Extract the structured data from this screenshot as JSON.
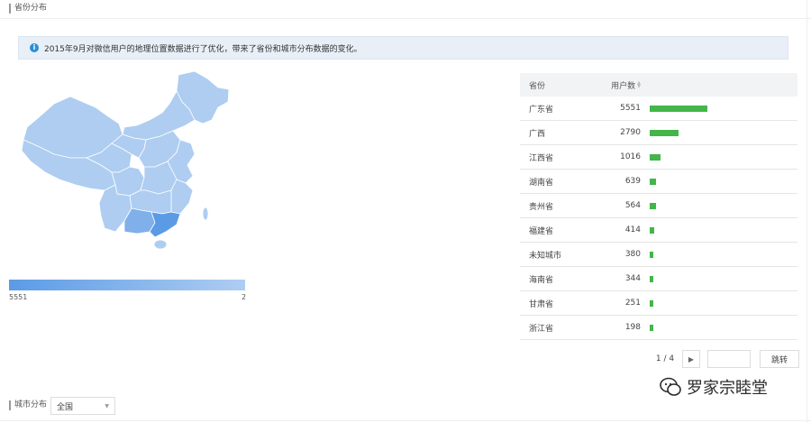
{
  "section": {
    "title": "省份分布"
  },
  "notice": {
    "text": "2015年9月对微信用户的地理位置数据进行了优化，带来了省份和城市分布数据的变化。"
  },
  "map": {
    "colors": {
      "high": "#5b9be6",
      "mid": "#7fb0ea",
      "low": "#aecdf1",
      "border": "#ffffff"
    },
    "legend_max": "5551",
    "legend_min": "2"
  },
  "table": {
    "headers": {
      "province": "省份",
      "users": "用户数"
    },
    "rows": [
      {
        "province": "广东省",
        "users": "5551",
        "value": 5551
      },
      {
        "province": "广西",
        "users": "2790",
        "value": 2790
      },
      {
        "province": "江西省",
        "users": "1016",
        "value": 1016
      },
      {
        "province": "湖南省",
        "users": "639",
        "value": 639
      },
      {
        "province": "贵州省",
        "users": "564",
        "value": 564
      },
      {
        "province": "福建省",
        "users": "414",
        "value": 414
      },
      {
        "province": "未知城市",
        "users": "380",
        "value": 380
      },
      {
        "province": "海南省",
        "users": "344",
        "value": 344
      },
      {
        "province": "甘肃省",
        "users": "251",
        "value": 251
      },
      {
        "province": "浙江省",
        "users": "198",
        "value": 198
      }
    ],
    "bar_color": "#44b549",
    "max_value": 5551
  },
  "pager": {
    "info": "1 / 4",
    "next_icon": "chevron-right",
    "jump_label": "跳转"
  },
  "city": {
    "label": "城市分布",
    "selected": "全国"
  },
  "watermark": {
    "text": "罗家宗睦堂"
  }
}
